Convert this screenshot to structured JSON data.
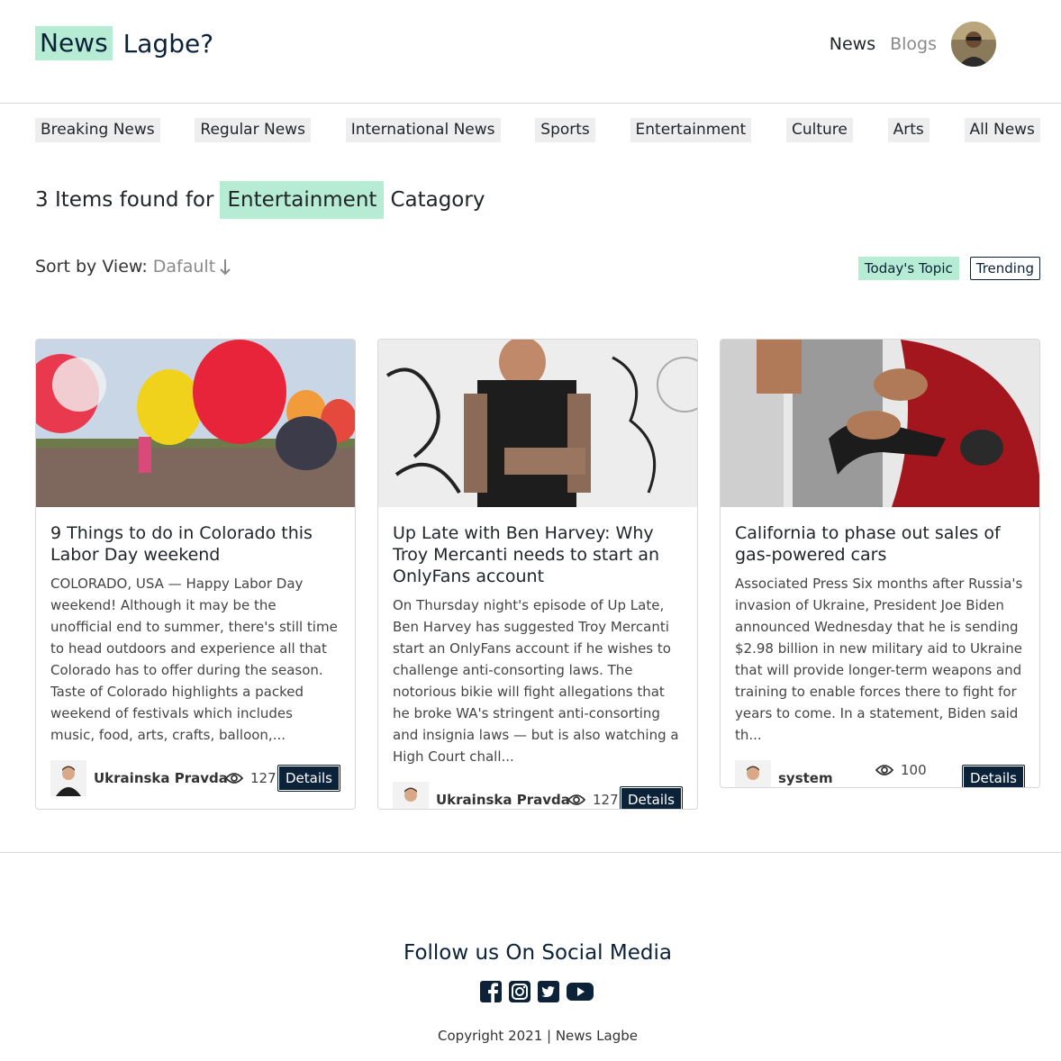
{
  "header": {
    "logo_highlight": "News",
    "logo_rest": "Lagbe?",
    "nav": {
      "news": "News",
      "blogs": "Blogs"
    }
  },
  "categories": [
    "Breaking News",
    "Regular News",
    "International News",
    "Sports",
    "Entertainment",
    "Culture",
    "Arts",
    "All News"
  ],
  "results": {
    "prefix": "3 Items found for",
    "category": "Entertainment",
    "suffix": "Catagory"
  },
  "sort": {
    "label": "Sort by View:",
    "value": "Dafault"
  },
  "topics": {
    "today": "Today's Topic",
    "trending": "Trending"
  },
  "cards": [
    {
      "title": "9 Things to do in Colorado this Labor Day weekend",
      "excerpt": "COLORADO, USA — Happy Labor Day weekend! Although it may be the unofficial end to summer, there's still time to head outdoors and experience all that Colorado has to offer during the season. Taste of Colorado highlights a packed weekend of festivals which includes music, food, arts, crafts, balloon,...",
      "author": "Ukrainska Pravda",
      "views": "127",
      "details": "Details"
    },
    {
      "title": "Up Late with Ben Harvey: Why Troy Mercanti needs to start an OnlyFans account",
      "excerpt": "On Thursday night's episode of Up Late, Ben Harvey has suggested Troy Mercanti start an OnlyFans account if he wishes to challenge anti-consorting laws. The notorious bikie will fight allegations that he broke WA's stringent anti-consorting and insignia laws — but is also watching a High Court chall...",
      "author": "Ukrainska Pravda",
      "views": "127",
      "details": "Details"
    },
    {
      "title": "California to phase out sales of gas-powered cars",
      "excerpt": "Associated Press Six months after Russia's invasion of Ukraine, President Joe Biden announced Wednesday that he is sending $2.98 billion in new military aid to Ukraine that will provide longer-term weapons and training to enable forces there to fight for years to come. In a statement, Biden said th...",
      "author": "system",
      "views": "100",
      "details": "Details"
    }
  ],
  "footer": {
    "follow": "Follow us On Social Media",
    "socials": [
      "facebook-icon",
      "instagram-icon",
      "twitter-icon",
      "youtube-icon"
    ],
    "copyright": "Copyright 2021 | News Lagbe"
  },
  "colors": {
    "accent": "#b6ecd3",
    "navy": "#0b2239",
    "chip": "#eeeeee"
  }
}
